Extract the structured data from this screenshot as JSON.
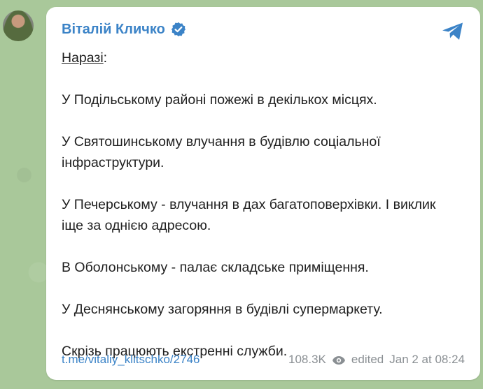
{
  "post": {
    "author": "Віталій Кличко",
    "intro_label": "Наразі",
    "intro_suffix": ":",
    "paragraphs": [
      "У Подільському районі пожежі в декількох місцях.",
      "У Святошинському влучання в будівлю соціальної інфраструктури.",
      "У Печерському - влучання в дах багатоповерхівки. І виклик іще за однією адресою.",
      "В Оболонському - палає складське приміщення.",
      "У Деснянському загоряння в будівлі супермаркету.",
      "Скрізь працюють екстренні служби."
    ],
    "link_text": "t.me/vitaliy_klitschko/2746",
    "views": "108.3K",
    "edited_label": "edited",
    "timestamp": "Jan 2 at 08:24"
  },
  "icons": {
    "verified": "verified-check-icon",
    "share": "telegram-share-icon",
    "views": "eye-icon"
  },
  "colors": {
    "accent": "#3b83c7",
    "background": "#a9c89a",
    "bubble": "#ffffff",
    "meta": "#8a8f93"
  }
}
